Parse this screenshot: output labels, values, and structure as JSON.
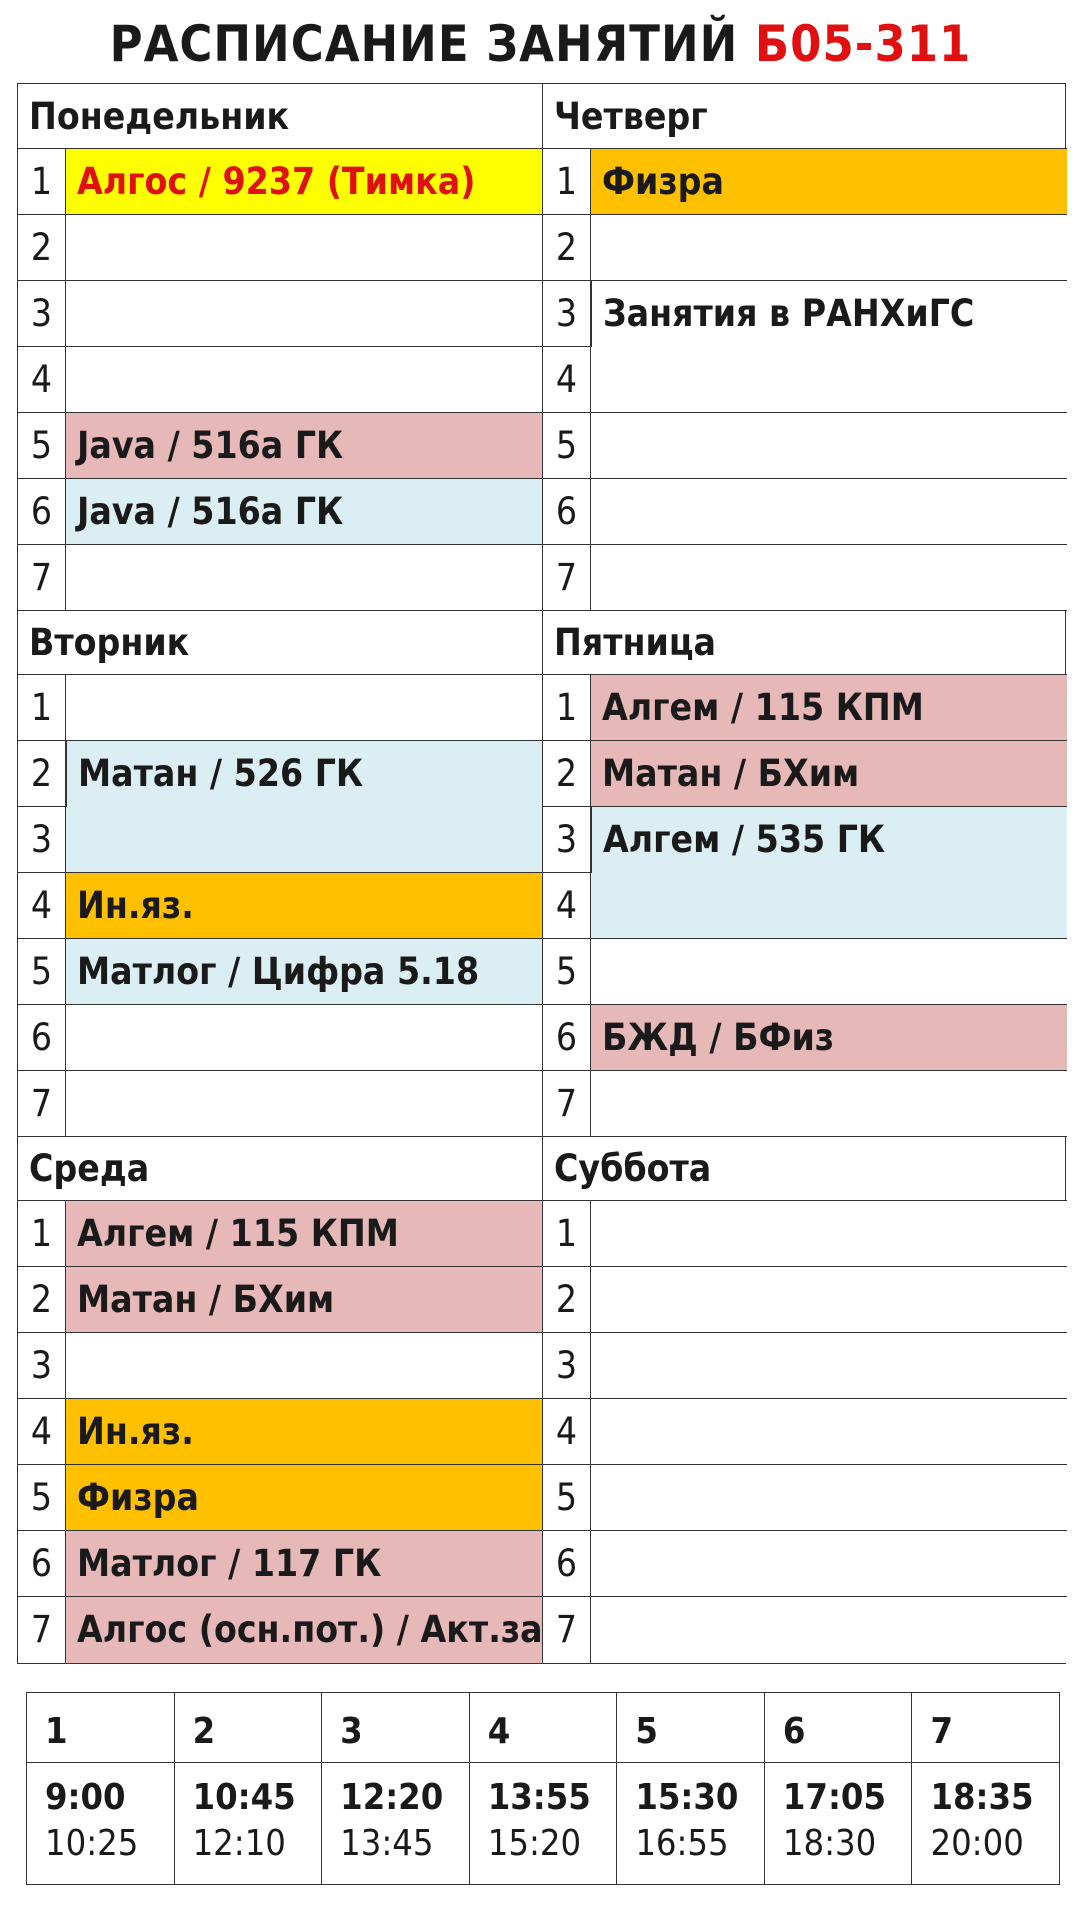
{
  "title": {
    "text": "РАСПИСАНИЕ ЗАНЯТИЙ",
    "group": "Б05-311"
  },
  "left_days": [
    {
      "name": "Понедельник",
      "rows": [
        {
          "num": "1",
          "text": "Алгос / 9237 (Тимка)",
          "color": "yellow",
          "red_text": true
        },
        {
          "num": "2",
          "text": "",
          "color": "white"
        },
        {
          "num": "3",
          "text": "",
          "color": "white"
        },
        {
          "num": "4",
          "text": "",
          "color": "white"
        },
        {
          "num": "5",
          "text": "Java / 516а ГК",
          "color": "pink"
        },
        {
          "num": "6",
          "text": "Java / 516а ГК",
          "color": "blue"
        },
        {
          "num": "7",
          "text": "",
          "color": "white"
        }
      ]
    },
    {
      "name": "Вторник",
      "rows": [
        {
          "num": "1",
          "text": "",
          "color": "white"
        },
        {
          "num": "2",
          "text": "Матан / 526 ГК",
          "color": "blue",
          "span": 2
        },
        {
          "num": "3",
          "text": "",
          "color": "blue",
          "covered": true
        },
        {
          "num": "4",
          "text": "Ин.яз.",
          "color": "orange"
        },
        {
          "num": "5",
          "text": "Матлог / Цифра 5.18",
          "color": "blue"
        },
        {
          "num": "6",
          "text": "",
          "color": "white"
        },
        {
          "num": "7",
          "text": "",
          "color": "white"
        }
      ]
    },
    {
      "name": "Среда",
      "rows": [
        {
          "num": "1",
          "text": "Алгем / 115 КПМ",
          "color": "pink"
        },
        {
          "num": "2",
          "text": "Матан / БХим",
          "color": "pink"
        },
        {
          "num": "3",
          "text": "",
          "color": "white"
        },
        {
          "num": "4",
          "text": "Ин.яз.",
          "color": "orange"
        },
        {
          "num": "5",
          "text": "Физра",
          "color": "orange"
        },
        {
          "num": "6",
          "text": "Матлог / 117 ГК",
          "color": "pink"
        },
        {
          "num": "7",
          "text": "Алгос (осн.пот.) / Акт.зал",
          "color": "pink"
        }
      ]
    }
  ],
  "right_days": [
    {
      "name": "Четверг",
      "rows": [
        {
          "num": "1",
          "text": "Физра",
          "color": "orange"
        },
        {
          "num": "2",
          "text": "",
          "color": "white"
        },
        {
          "num": "3",
          "text": "Занятия в РАНХиГС",
          "color": "white",
          "span": 5
        },
        {
          "num": "4",
          "text": "",
          "color": "white",
          "covered": true
        },
        {
          "num": "5",
          "text": "",
          "color": "white",
          "covered": true
        },
        {
          "num": "6",
          "text": "",
          "color": "white",
          "covered": true
        },
        {
          "num": "7",
          "text": "",
          "color": "white",
          "covered": true
        }
      ]
    },
    {
      "name": "Пятница",
      "rows": [
        {
          "num": "1",
          "text": "Алгем / 115 КПМ",
          "color": "pink"
        },
        {
          "num": "2",
          "text": "Матан / БХим",
          "color": "pink"
        },
        {
          "num": "3",
          "text": "Алгем / 535 ГК",
          "color": "blue",
          "span": 2
        },
        {
          "num": "4",
          "text": "",
          "color": "blue",
          "covered": true
        },
        {
          "num": "5",
          "text": "",
          "color": "white"
        },
        {
          "num": "6",
          "text": "БЖД / БФиз",
          "color": "pink"
        },
        {
          "num": "7",
          "text": "",
          "color": "white"
        }
      ]
    },
    {
      "name": "Суббота",
      "rows": [
        {
          "num": "1",
          "text": "",
          "color": "white"
        },
        {
          "num": "2",
          "text": "",
          "color": "white"
        },
        {
          "num": "3",
          "text": "",
          "color": "white"
        },
        {
          "num": "4",
          "text": "",
          "color": "white"
        },
        {
          "num": "5",
          "text": "",
          "color": "white"
        },
        {
          "num": "6",
          "text": "",
          "color": "white"
        },
        {
          "num": "7",
          "text": "",
          "color": "white"
        }
      ]
    }
  ],
  "times": [
    {
      "num": "1",
      "start": "9:00",
      "end": "10:25"
    },
    {
      "num": "2",
      "start": "10:45",
      "end": "12:10"
    },
    {
      "num": "3",
      "start": "12:20",
      "end": "13:45"
    },
    {
      "num": "4",
      "start": "13:55",
      "end": "15:20"
    },
    {
      "num": "5",
      "start": "15:30",
      "end": "16:55"
    },
    {
      "num": "6",
      "start": "17:05",
      "end": "18:30"
    },
    {
      "num": "7",
      "start": "18:35",
      "end": "20:00"
    }
  ],
  "colors": {
    "yellow": "#ffff00",
    "orange": "#ffc000",
    "pink": "#e6b8b7",
    "blue": "#daeef3",
    "white": "#ffffff",
    "title_red": "#e01010"
  }
}
